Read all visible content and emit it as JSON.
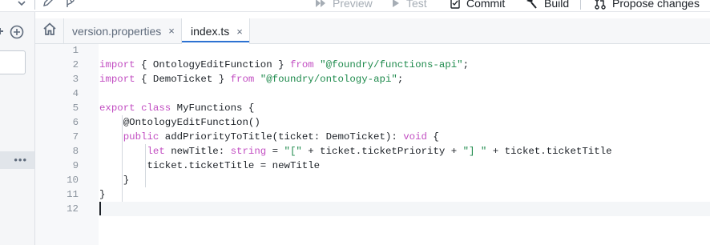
{
  "toolbar": {
    "preview": "Preview",
    "test": "Test",
    "commit": "Commit",
    "build": "Build",
    "propose": "Propose changes"
  },
  "tabs": [
    {
      "label": "version.properties",
      "close": "×",
      "active": false
    },
    {
      "label": "index.ts",
      "close": "×",
      "active": true
    }
  ],
  "left_panel": {
    "more": "•••"
  },
  "editor": {
    "line_numbers": [
      "1",
      "2",
      "3",
      "4",
      "5",
      "6",
      "7",
      "8",
      "9",
      "10",
      "11",
      "12"
    ],
    "lines": [
      [],
      [
        {
          "t": "import",
          "c": "kw"
        },
        {
          "t": " { OntologyEditFunction } ",
          "c": "pl"
        },
        {
          "t": "from",
          "c": "kw"
        },
        {
          "t": " ",
          "c": "pl"
        },
        {
          "t": "\"@foundry/functions-api\"",
          "c": "str"
        },
        {
          "t": ";",
          "c": "pl"
        }
      ],
      [
        {
          "t": "import",
          "c": "kw"
        },
        {
          "t": " { DemoTicket } ",
          "c": "pl"
        },
        {
          "t": "from",
          "c": "kw"
        },
        {
          "t": " ",
          "c": "pl"
        },
        {
          "t": "\"@foundry/ontology-api\"",
          "c": "str"
        },
        {
          "t": ";",
          "c": "pl"
        }
      ],
      [],
      [
        {
          "t": "export",
          "c": "kw"
        },
        {
          "t": " ",
          "c": "pl"
        },
        {
          "t": "class",
          "c": "kw"
        },
        {
          "t": " MyFunctions {",
          "c": "pl"
        }
      ],
      [
        {
          "t": "    @OntologyEditFunction()",
          "c": "pl"
        }
      ],
      [
        {
          "t": "    ",
          "c": "pl"
        },
        {
          "t": "public",
          "c": "kw"
        },
        {
          "t": " addPriorityToTitle(ticket: DemoTicket): ",
          "c": "pl"
        },
        {
          "t": "void",
          "c": "kw"
        },
        {
          "t": " {",
          "c": "pl"
        }
      ],
      [
        {
          "t": "        ",
          "c": "pl"
        },
        {
          "t": "let",
          "c": "kw"
        },
        {
          "t": " newTitle: ",
          "c": "pl"
        },
        {
          "t": "string",
          "c": "kw"
        },
        {
          "t": " = ",
          "c": "pl"
        },
        {
          "t": "\"[\"",
          "c": "str"
        },
        {
          "t": " + ticket.ticketPriority + ",
          "c": "pl"
        },
        {
          "t": "\"] \"",
          "c": "str"
        },
        {
          "t": " + ticket.ticketTitle",
          "c": "pl"
        }
      ],
      [
        {
          "t": "        ticket.ticketTitle = newTitle",
          "c": "pl"
        }
      ],
      [
        {
          "t": "    }",
          "c": "pl"
        }
      ],
      [
        {
          "t": "}",
          "c": "pl"
        }
      ],
      []
    ],
    "cursor_line": 12
  },
  "colors": {
    "accent": "#2d72d2",
    "keyword": "#c24ec2",
    "string": "#1e8a4c"
  }
}
